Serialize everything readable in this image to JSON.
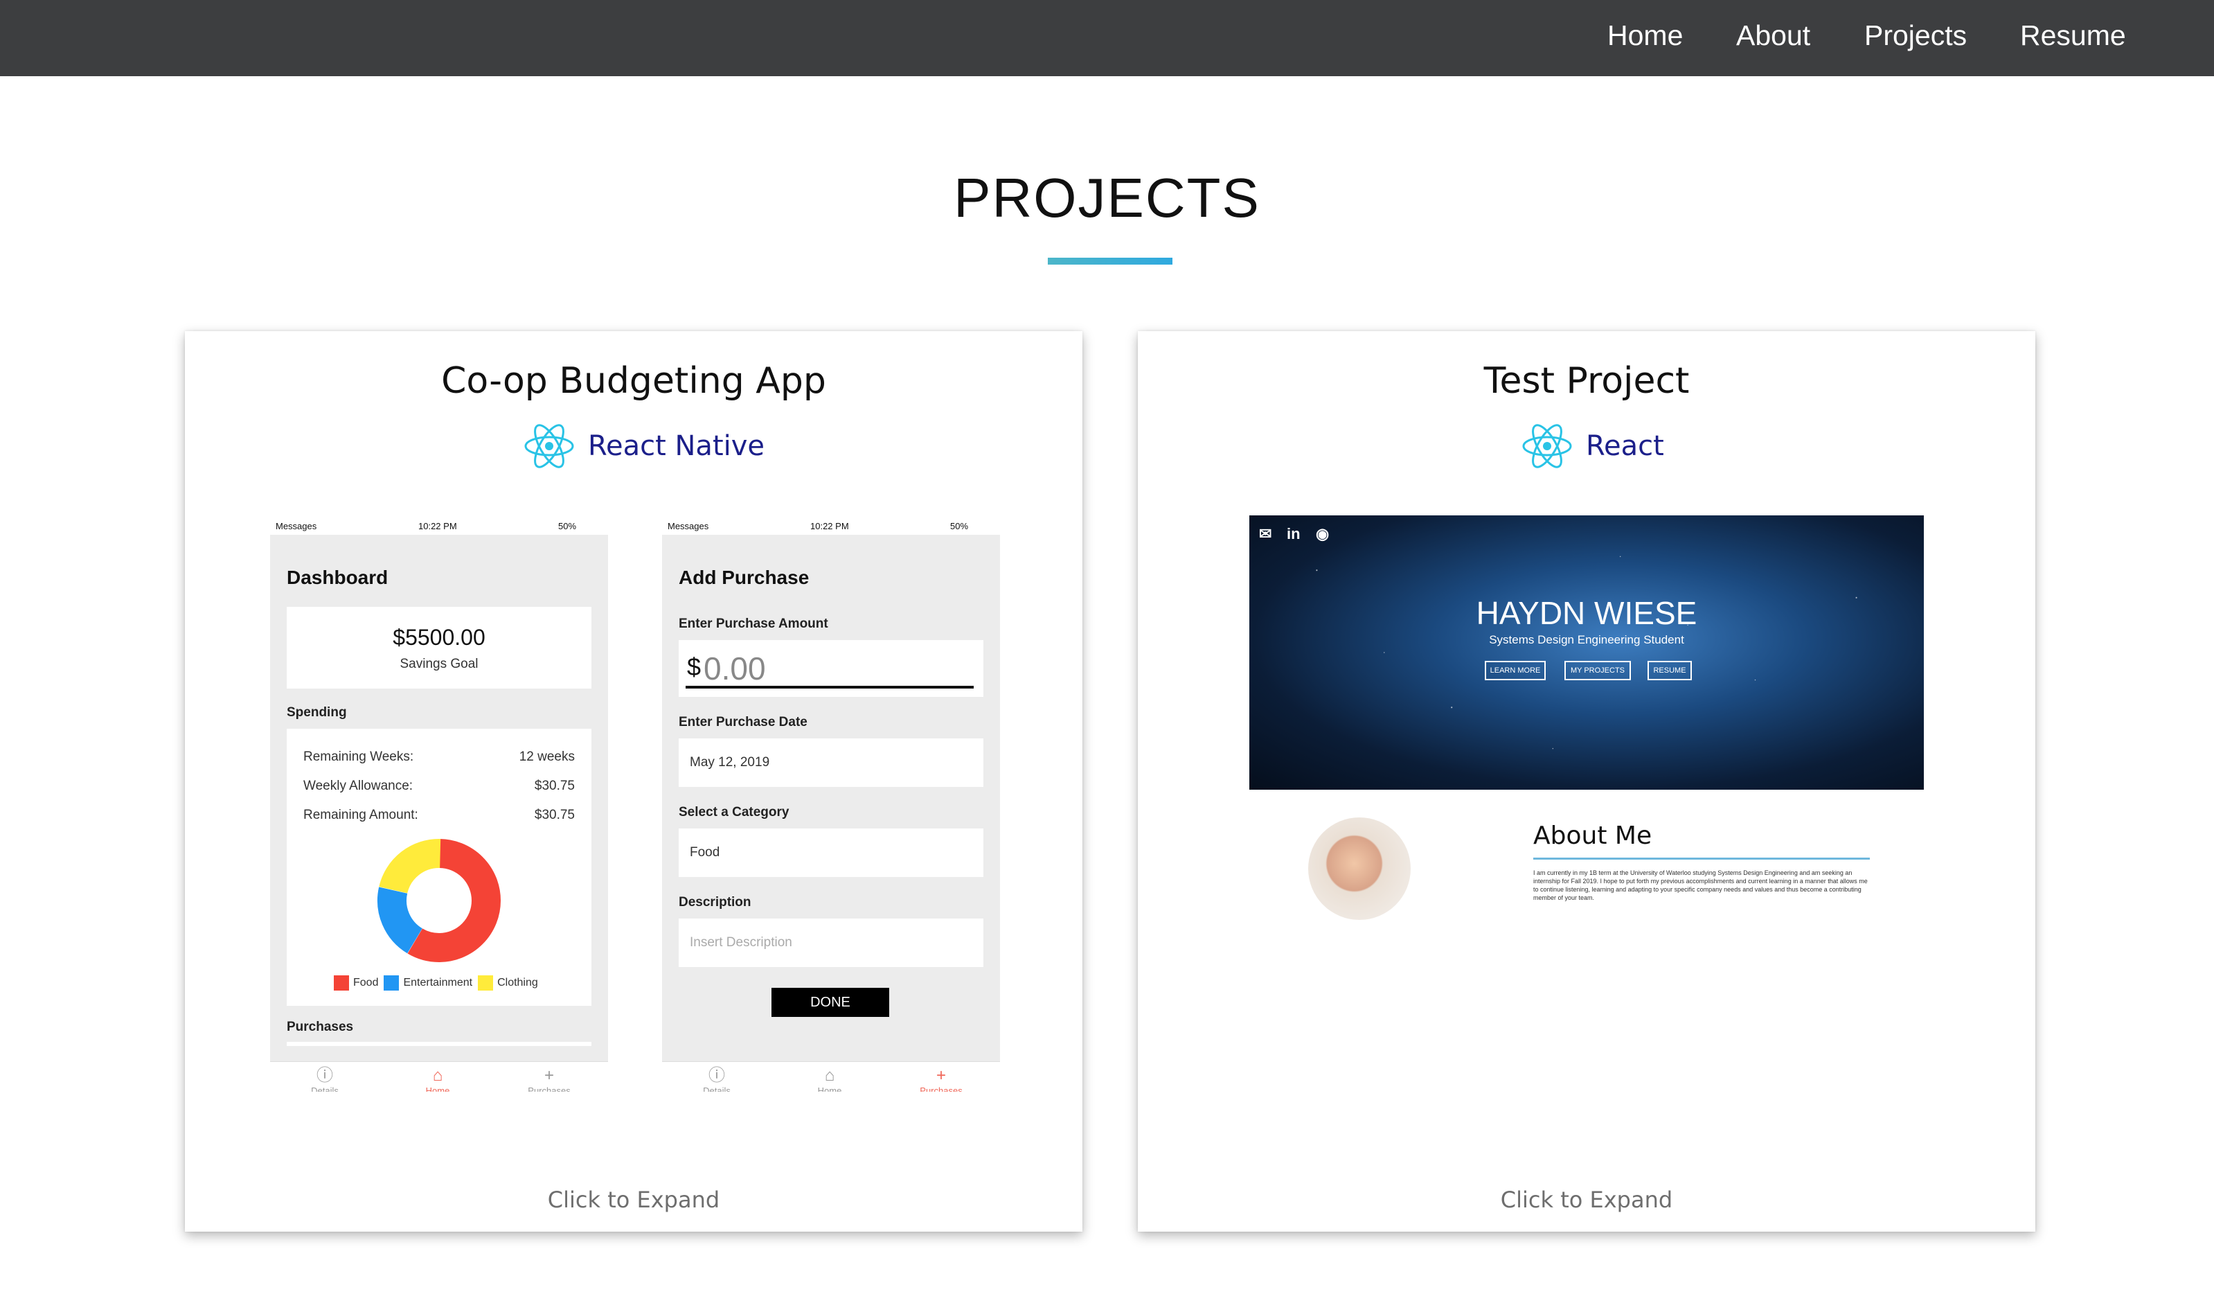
{
  "nav": {
    "items": [
      "Home",
      "About",
      "Projects",
      "Resume"
    ]
  },
  "page": {
    "title": "PROJECTS",
    "accent": "#34abd8"
  },
  "projects": [
    {
      "title": "Co-op Budgeting App",
      "tech": "React Native",
      "expand": "Click to Expand",
      "dashboard": {
        "status": {
          "left": "Messages",
          "time": "10:22 PM",
          "battery": "50%"
        },
        "heading": "Dashboard",
        "goal_amount": "$5500.00",
        "goal_label": "Savings Goal",
        "spending_label": "Spending",
        "rows": [
          {
            "label": "Remaining Weeks:",
            "value": "12 weeks"
          },
          {
            "label": "Weekly Allowance:",
            "value": "$30.75"
          },
          {
            "label": "Remaining Amount:",
            "value": "$30.75"
          }
        ],
        "legend": [
          {
            "name": "Food",
            "color": "#f44336"
          },
          {
            "name": "Entertainment",
            "color": "#2196f3"
          },
          {
            "name": "Clothing",
            "color": "#ffeb3b"
          }
        ],
        "purchases_label": "Purchases",
        "tabs": [
          "Details",
          "Home",
          "Purchases"
        ]
      },
      "add_purchase": {
        "status": {
          "left": "Messages",
          "time": "10:22 PM",
          "battery": "50%"
        },
        "heading": "Add Purchase",
        "amount_label": "Enter Purchase Amount",
        "amount_prefix": "$",
        "amount_value": "0.00",
        "date_label": "Enter Purchase Date",
        "date_value": "May 12, 2019",
        "category_label": "Select a Category",
        "category_value": "Food",
        "description_label": "Description",
        "description_placeholder": "Insert Description",
        "done_label": "DONE",
        "tabs": [
          "Details",
          "Home",
          "Purchases"
        ]
      }
    },
    {
      "title": "Test Project",
      "tech": "React",
      "expand": "Click to Expand",
      "site": {
        "name": "HAYDN WIESE",
        "subtitle": "Systems Design Engineering Student",
        "buttons": [
          "LEARN MORE",
          "MY PROJECTS",
          "RESUME"
        ],
        "icons": [
          "mail-icon",
          "linkedin-icon",
          "github-icon"
        ],
        "about_title": "About Me",
        "about_text": "I am currently in my 1B term at the University of Waterloo studying Systems Design Engineering and am seeking an internship for Fall 2019. I hope to put forth my previous accomplishments and current learning in a manner that allows me to continue listening, learning and adapting to your specific company needs and values and thus become a contributing member of your team."
      }
    }
  ]
}
